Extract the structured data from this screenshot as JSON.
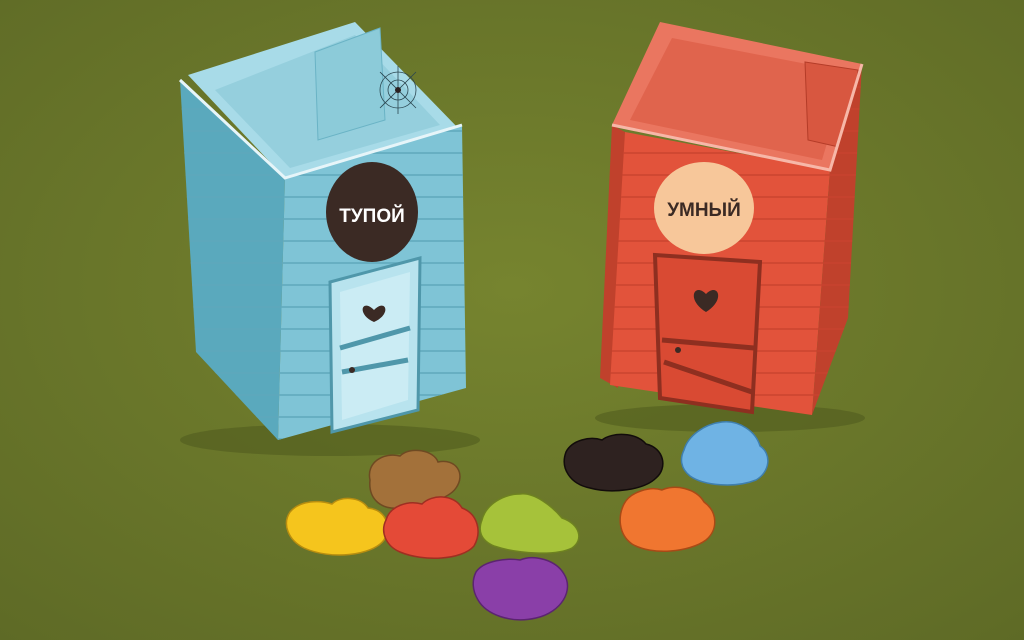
{
  "scene": {
    "background": "#6e7a2e",
    "boxes": [
      {
        "id": "blue-box",
        "label": "ТУПОЙ",
        "color": "#7fc4d6",
        "dark": "#5aa9bd",
        "inner": "#a8dbe8",
        "badge_color": "#3b2a24",
        "badge_text_color": "#ffffff"
      },
      {
        "id": "red-box",
        "label": "УМНЫЙ",
        "color": "#e2533b",
        "dark": "#c0412c",
        "inner": "#ea7660",
        "badge_color": "#f7c79a",
        "badge_text_color": "#3b2a24"
      }
    ],
    "tokens": [
      {
        "name": "brown-token",
        "color": "#a3713a"
      },
      {
        "name": "yellow-token",
        "color": "#f5c51d"
      },
      {
        "name": "red-token",
        "color": "#e44a37"
      },
      {
        "name": "lime-token",
        "color": "#a6c23a"
      },
      {
        "name": "purple-token",
        "color": "#8a3fa8"
      },
      {
        "name": "black-token",
        "color": "#2e2220"
      },
      {
        "name": "blue-token",
        "color": "#6fb3e4"
      },
      {
        "name": "orange-token",
        "color": "#f07630"
      }
    ]
  }
}
